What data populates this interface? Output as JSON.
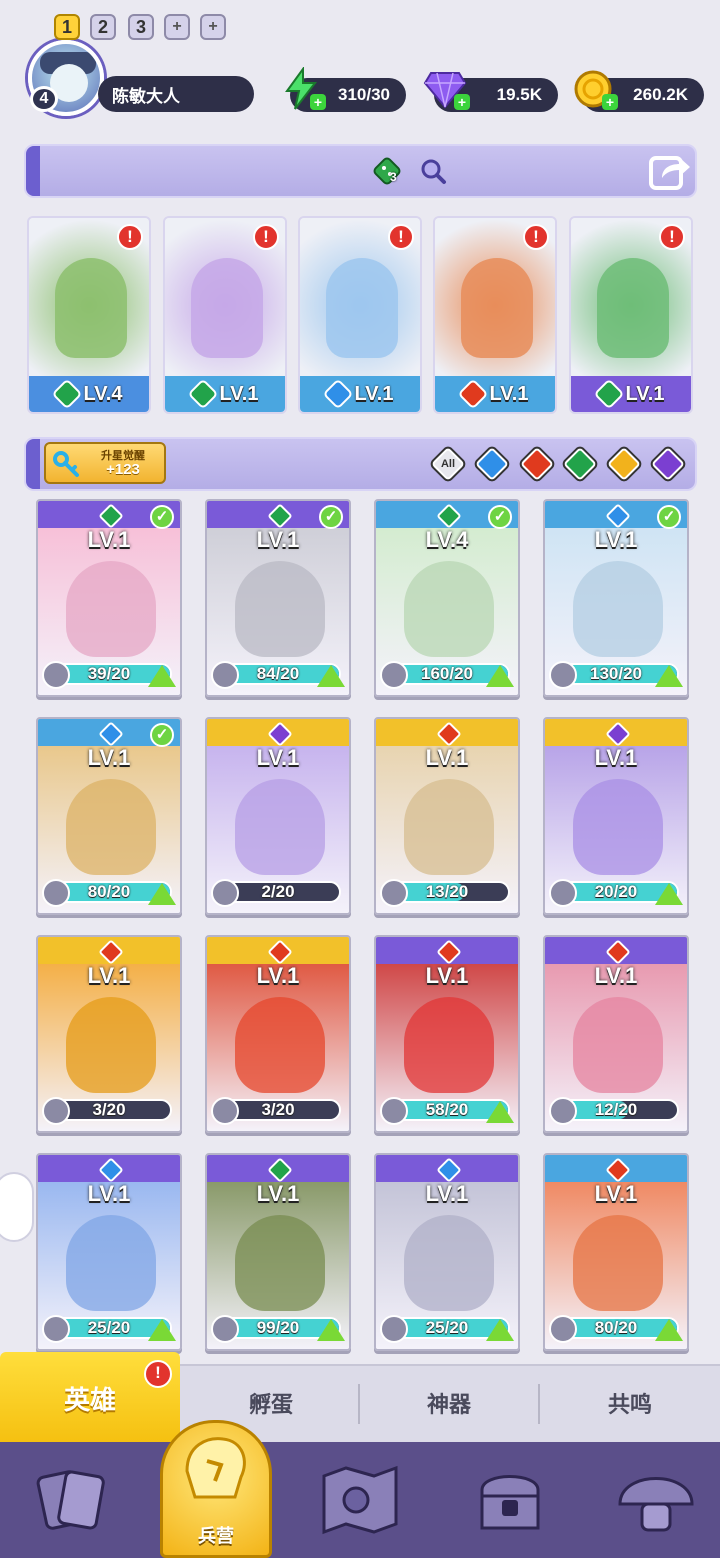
{
  "player": {
    "level": "4",
    "name": "陈敏大人"
  },
  "resources": {
    "energy": "310/30",
    "gems": "19.5K",
    "gold": "260.2K"
  },
  "team_bar": {
    "tabs": [
      "1",
      "2",
      "3"
    ],
    "add_labels": [
      "+",
      "+"
    ],
    "dice_count": "3"
  },
  "team": [
    {
      "level": "LV.4",
      "element": "nature",
      "alert": "!"
    },
    {
      "level": "LV.1",
      "element": "nature",
      "alert": "!"
    },
    {
      "level": "LV.1",
      "element": "water",
      "alert": "!"
    },
    {
      "level": "LV.1",
      "element": "fire",
      "alert": "!"
    },
    {
      "level": "LV.1",
      "element": "nature",
      "alert": "!"
    }
  ],
  "star_awaken": {
    "title": "升星觉醒",
    "value": "+123"
  },
  "filters": {
    "all_label": "All",
    "elements": [
      "water",
      "fire",
      "nature",
      "light",
      "dark"
    ]
  },
  "heroes": [
    {
      "level": "LV.1",
      "element": "nature",
      "progress": "39/20",
      "fill": 1.0,
      "checked": true,
      "upgrade": true,
      "frame": "purple"
    },
    {
      "level": "LV.1",
      "element": "nature",
      "progress": "84/20",
      "fill": 1.0,
      "checked": true,
      "upgrade": true,
      "frame": "purple"
    },
    {
      "level": "LV.4",
      "element": "nature",
      "progress": "160/20",
      "fill": 1.0,
      "checked": true,
      "upgrade": true,
      "frame": "blue"
    },
    {
      "level": "LV.1",
      "element": "water",
      "progress": "130/20",
      "fill": 1.0,
      "checked": true,
      "upgrade": true,
      "frame": "blue"
    },
    {
      "level": "LV.1",
      "element": "water",
      "progress": "80/20",
      "fill": 1.0,
      "checked": true,
      "upgrade": true,
      "frame": "blue"
    },
    {
      "level": "LV.1",
      "element": "dark",
      "progress": "2/20",
      "fill": 0.1,
      "checked": false,
      "upgrade": false,
      "frame": "gold"
    },
    {
      "level": "LV.1",
      "element": "fire",
      "progress": "13/20",
      "fill": 0.65,
      "checked": false,
      "upgrade": false,
      "frame": "gold"
    },
    {
      "level": "LV.1",
      "element": "dark",
      "progress": "20/20",
      "fill": 1.0,
      "checked": false,
      "upgrade": true,
      "frame": "gold"
    },
    {
      "level": "LV.1",
      "element": "fire",
      "progress": "3/20",
      "fill": 0.15,
      "checked": false,
      "upgrade": false,
      "frame": "gold"
    },
    {
      "level": "LV.1",
      "element": "fire",
      "progress": "3/20",
      "fill": 0.15,
      "checked": false,
      "upgrade": false,
      "frame": "gold"
    },
    {
      "level": "LV.1",
      "element": "fire",
      "progress": "58/20",
      "fill": 1.0,
      "checked": false,
      "upgrade": true,
      "frame": "purple"
    },
    {
      "level": "LV.1",
      "element": "fire",
      "progress": "12/20",
      "fill": 0.6,
      "checked": false,
      "upgrade": false,
      "frame": "purple"
    },
    {
      "level": "LV.1",
      "element": "water",
      "progress": "25/20",
      "fill": 1.0,
      "checked": false,
      "upgrade": true,
      "frame": "purple"
    },
    {
      "level": "LV.1",
      "element": "nature",
      "progress": "99/20",
      "fill": 1.0,
      "checked": false,
      "upgrade": true,
      "frame": "purple"
    },
    {
      "level": "LV.1",
      "element": "water",
      "progress": "25/20",
      "fill": 1.0,
      "checked": false,
      "upgrade": true,
      "frame": "purple"
    },
    {
      "level": "LV.1",
      "element": "fire",
      "progress": "80/20",
      "fill": 1.0,
      "checked": false,
      "upgrade": true,
      "frame": "blue"
    }
  ],
  "sub_tabs": {
    "heroes": "英雄",
    "hatch": "孵蛋",
    "artifacts": "神器",
    "resonance": "共鸣",
    "alert": "!"
  },
  "nav": {
    "barracks": "兵营"
  },
  "colors": {
    "water": "#2f8fe8",
    "fire": "#e03a1e",
    "nature": "#22a34a",
    "light": "#f2b21c",
    "dark": "#7b3fd1",
    "purple": "#7a5ad8",
    "blue": "#4aa6e0",
    "gold": "#f2c12a"
  }
}
